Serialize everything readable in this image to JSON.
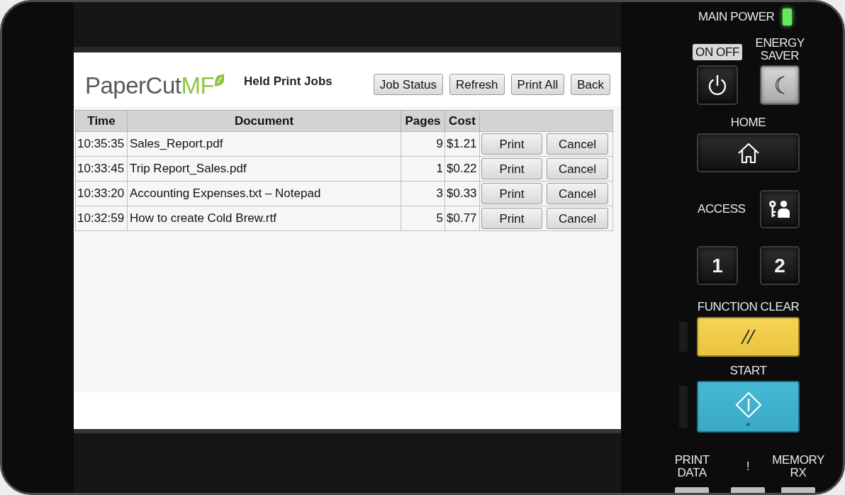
{
  "screen": {
    "logo": {
      "text": "PaperCut",
      "accent": "MF"
    },
    "title": "Held Print Jobs",
    "buttons": [
      "Job Status",
      "Refresh",
      "Print All",
      "Back"
    ],
    "table": {
      "columns": [
        "Time",
        "Document",
        "Pages",
        "Cost"
      ],
      "rows": [
        {
          "time": "10:35:35",
          "document": "Sales_Report.pdf",
          "pages": "9",
          "cost": "$1.21",
          "actions": [
            "Print",
            "Cancel"
          ]
        },
        {
          "time": "10:33:45",
          "document": "Trip Report_Sales.pdf",
          "pages": "1",
          "cost": "$0.22",
          "actions": [
            "Print",
            "Cancel"
          ]
        },
        {
          "time": "10:33:20",
          "document": "Accounting Expenses.txt – Notepad",
          "pages": "3",
          "cost": "$0.33",
          "actions": [
            "Print",
            "Cancel"
          ]
        },
        {
          "time": "10:32:59",
          "document": "How to create Cold Brew.rtf",
          "pages": "5",
          "cost": "$0.77",
          "actions": [
            "Print",
            "Cancel"
          ]
        }
      ]
    }
  },
  "control_panel": {
    "main_power": {
      "label": "MAIN POWER",
      "lit": true
    },
    "power_key": {
      "label": "ON OFF"
    },
    "energy_saver_key": {
      "label": "ENERGY SAVER",
      "lit": true
    },
    "home_key": {
      "label": "HOME"
    },
    "access_key": {
      "label": "ACCESS"
    },
    "number_keys": [
      "1",
      "2"
    ],
    "function_clear_key": {
      "label": "FUNCTION CLEAR"
    },
    "start_key": {
      "label": "START"
    },
    "indicators": [
      "PRINT DATA",
      "!",
      "MEMORY RX"
    ]
  }
}
